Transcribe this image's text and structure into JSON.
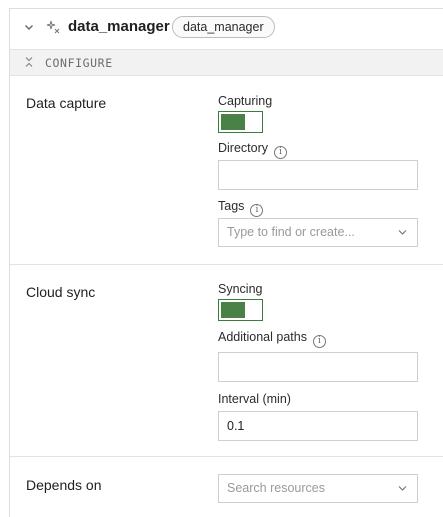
{
  "header": {
    "title": "data_manager",
    "badge": "data_manager"
  },
  "configure": {
    "label": "CONFIGURE"
  },
  "data_capture": {
    "title": "Data capture",
    "capturing_label": "Capturing",
    "capturing_on": true,
    "directory_label": "Directory",
    "directory_value": "",
    "tags_label": "Tags",
    "tags_placeholder": "Type to find or create..."
  },
  "cloud_sync": {
    "title": "Cloud sync",
    "syncing_label": "Syncing",
    "syncing_on": true,
    "additional_paths_label": "Additional paths",
    "additional_paths_value": "",
    "interval_label": "Interval (min)",
    "interval_value": "0.1"
  },
  "depends_on": {
    "title": "Depends on",
    "placeholder": "Search resources"
  },
  "colors": {
    "toggle_on": "#4a8146"
  }
}
